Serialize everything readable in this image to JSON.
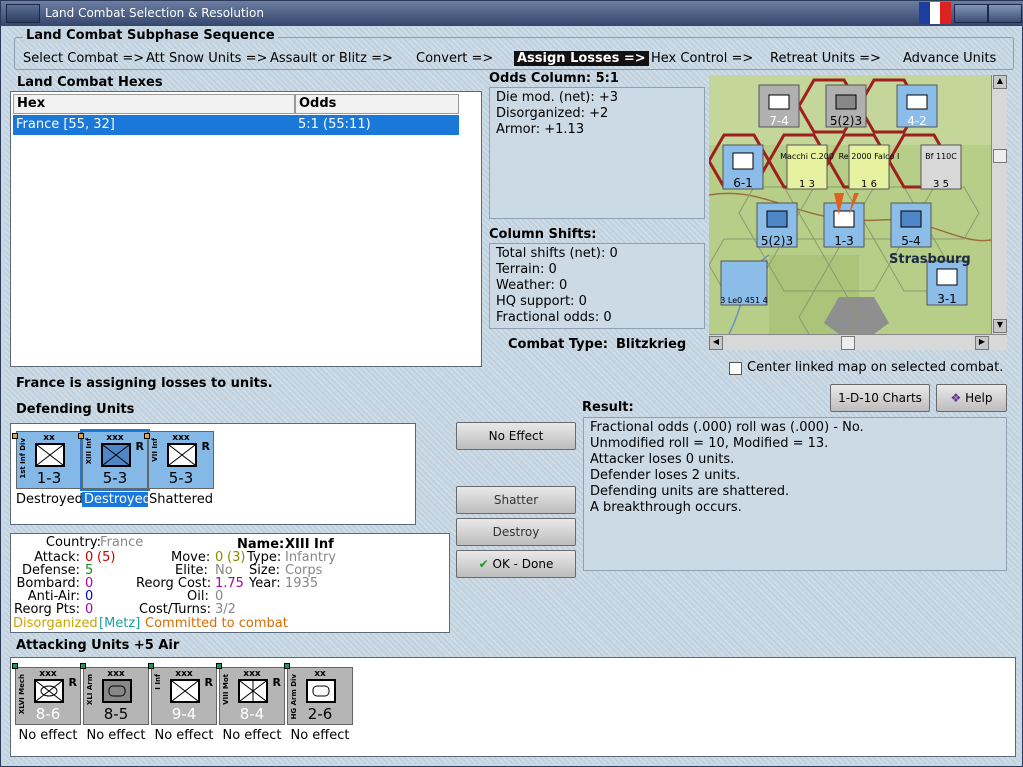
{
  "window": {
    "title": "Land Combat Selection & Resolution"
  },
  "sequence": {
    "title": "Land Combat Subphase Sequence",
    "steps": [
      "Select Combat =>",
      "Att Snow Units =>",
      "Assault or Blitz =>",
      "Convert =>",
      "Assign Losses =>",
      "Hex Control =>",
      "Retreat Units =>",
      "Advance Units"
    ],
    "active_index": 4
  },
  "hexes": {
    "title": "Land Combat Hexes",
    "columns": [
      "Hex",
      "Odds"
    ],
    "rows": [
      {
        "hex": "France [55, 32]",
        "odds": "5:1 (55:11)"
      }
    ]
  },
  "odds": {
    "title": "Odds Column: 5:1",
    "lines": [
      "Die mod. (net): +3",
      "Disorganized: +2",
      "Armor: +1.13"
    ]
  },
  "shifts": {
    "title": "Column Shifts:",
    "lines": [
      "Total shifts (net): 0",
      "Terrain: 0",
      "Weather: 0",
      "HQ support: 0",
      "Fractional odds: 0"
    ]
  },
  "combat_type": {
    "label": "Combat Type:",
    "value": "Blitzkrieg"
  },
  "center_map": {
    "label": "Center linked map on selected combat.",
    "checked": false
  },
  "status": "France is assigning losses to units.",
  "defending": {
    "title": "Defending Units",
    "units": [
      {
        "size": "xx",
        "side": "1st Inf Div",
        "value": "1-3",
        "caption": "Destroyed",
        "r": "",
        "selected": false
      },
      {
        "size": "xxx",
        "side": "XIII Inf",
        "value": "5-3",
        "caption": "Destroyed",
        "r": "R",
        "selected": true
      },
      {
        "size": "xxx",
        "side": "VII Inf",
        "value": "5-3",
        "caption": "Shattered",
        "r": "R",
        "selected": false
      }
    ]
  },
  "buttons": {
    "no_effect": "No Effect",
    "shatter": "Shatter",
    "destroy": "Destroy",
    "ok": "OK - Done",
    "charts": "1-D-10 Charts",
    "help": "Help"
  },
  "result": {
    "title": "Result:",
    "lines": [
      "Fractional odds (.000) roll was (.000)  - No.",
      "Unmodified roll = 10, Modified = 13.",
      "Attacker loses 0 units.",
      "Defender loses 2 units.",
      "Defending units are shattered.",
      "A breakthrough occurs."
    ]
  },
  "details": {
    "country_label": "Country:",
    "country": "France",
    "name_label": "Name:",
    "name": "XIII Inf",
    "attack_label": "Attack:",
    "attack": "0",
    "attack_base": "(5)",
    "move_label": "Move:",
    "move": "0",
    "move_base": "(3)",
    "type_label": "Type:",
    "type": "Infantry",
    "defense_label": "Defense:",
    "defense": "5",
    "elite_label": "Elite:",
    "elite": "No",
    "size_label": "Size:",
    "size": "Corps",
    "bombard_label": "Bombard:",
    "bombard": "0",
    "reorg_label": "Reorg Cost:",
    "reorg": "1.75",
    "year_label": "Year:",
    "year": "1935",
    "antiair_label": "Anti-Air:",
    "antiair": "0",
    "oil_label": "Oil:",
    "oil": "0",
    "reorgpts_label": "Reorg Pts:",
    "reorgpts": "0",
    "cost_label": "Cost/Turns:",
    "cost": "3/2",
    "status_dis": "Disorganized",
    "status_loc": "[Metz]",
    "status_comm": "Committed to combat"
  },
  "attacking": {
    "title": "Attacking Units +5 Air",
    "units": [
      {
        "size": "xxx",
        "side": "XLVI Mech",
        "value": "8-6",
        "caption": "No effect",
        "r": "R"
      },
      {
        "size": "xxx",
        "side": "XLI Arm",
        "value": "8-5",
        "caption": "No effect",
        "r": ""
      },
      {
        "size": "xxx",
        "side": "I Inf",
        "value": "9-4",
        "caption": "No effect",
        "r": "R"
      },
      {
        "size": "xxx",
        "side": "VIII Mot",
        "value": "8-4",
        "caption": "No effect",
        "r": "R"
      },
      {
        "size": "xx",
        "side": "HG Arm Div",
        "value": "2-6",
        "caption": "No effect",
        "r": ""
      }
    ]
  },
  "map": {
    "place": "Strasbourg",
    "counters": [
      "7-4",
      "5(2)3",
      "4-2",
      "6-1",
      "1-3",
      "5(2)3",
      "5-4",
      "3-1",
      "1 3",
      "1 6",
      "3 5",
      "3 Le0 451 4",
      "Macchi C.200",
      "Re 2000 Falco I",
      "Bf 110C"
    ]
  },
  "colors": {
    "accent": "#1a78d8",
    "titlebar": "#34466c"
  }
}
